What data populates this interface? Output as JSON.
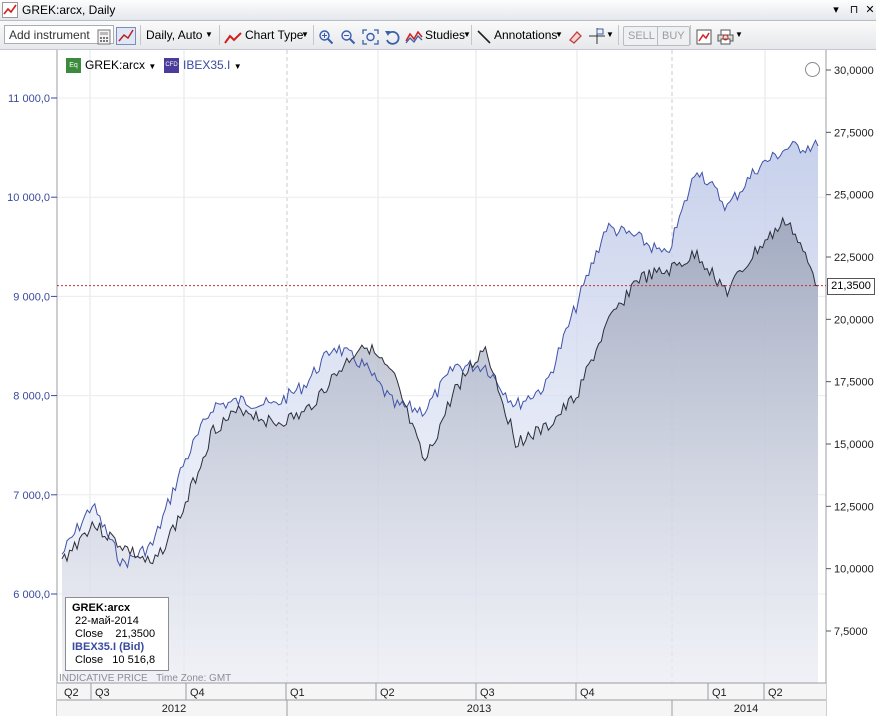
{
  "window": {
    "title": "GREK:arcx, Daily",
    "controls": [
      "▾",
      "⊓",
      "✕"
    ]
  },
  "toolbar": {
    "add_instrument_placeholder": "Add instrument",
    "interval": "Daily,  Auto",
    "chart_type": "Chart Type",
    "studies": "Studies",
    "annotations": "Annotations",
    "sell": "SELL",
    "buy": "BUY"
  },
  "legend": {
    "primary": "GREK:arcx",
    "secondary": "IBEX35.I",
    "primary_icon_label": "Eq",
    "secondary_icon_label": "CFD"
  },
  "axes": {
    "left_ticks": [
      "11 000,0",
      "10 000,0",
      "9 000,0",
      "8 000,0",
      "7 000,0",
      "6 000,0"
    ],
    "right_ticks": [
      "30,0000",
      "27,5000",
      "25,0000",
      "22,5000",
      "20,0000",
      "17,5000",
      "15,0000",
      "12,5000",
      "10,0000",
      "7,5000"
    ],
    "quarters": [
      "Q2",
      "Q3",
      "Q4",
      "Q1",
      "Q2",
      "Q3",
      "Q4",
      "Q1",
      "Q2"
    ],
    "years": [
      "2012",
      "2013",
      "2014"
    ]
  },
  "price_tag": "21,3500",
  "info": {
    "instrument": "GREK:arcx",
    "date": "22-май-2014",
    "close_label": "Close",
    "close_value": "21,3500",
    "instrument2": "IBEX35.I (Bid)",
    "close2_label": "Close",
    "close2_value": "10 516,8"
  },
  "footer": {
    "indicative": "INDICATIVE PRICE",
    "timezone": "Time Zone: GMT"
  },
  "colors": {
    "grek_line": "#2b2f3a",
    "ibex_line": "#3f52a8",
    "ref_line": "#c0303b"
  },
  "chart_data": {
    "type": "area",
    "x": [
      "2012-04",
      "2012-05",
      "2012-06",
      "2012-07",
      "2012-08",
      "2012-09",
      "2012-10",
      "2012-11",
      "2012-12",
      "2013-01",
      "2013-02",
      "2013-03",
      "2013-04",
      "2013-05",
      "2013-06",
      "2013-07",
      "2013-08",
      "2013-09",
      "2013-10",
      "2013-11",
      "2013-12",
      "2014-01",
      "2014-02",
      "2014-03",
      "2014-04",
      "2014-05"
    ],
    "series": [
      {
        "name": "GREK:arcx",
        "axis": "right",
        "values": [
          10.3,
          11.8,
          10.9,
          10.1,
          12.3,
          15.6,
          16.4,
          15.8,
          16.2,
          17.7,
          19.1,
          17.6,
          14.2,
          17.2,
          18.9,
          15.1,
          15.6,
          16.9,
          19.7,
          21.6,
          21.9,
          22.6,
          21.1,
          22.8,
          24.0,
          21.35
        ]
      },
      {
        "name": "IBEX35.I",
        "axis": "left",
        "values": [
          6400,
          6900,
          6300,
          6500,
          7300,
          7900,
          7950,
          7900,
          8100,
          8500,
          8300,
          7900,
          7850,
          8300,
          8300,
          7900,
          8100,
          8900,
          9700,
          9600,
          9400,
          10300,
          9900,
          10300,
          10500,
          10517
        ]
      }
    ],
    "left_ylim": [
      5500,
      11500
    ],
    "right_ylim": [
      5000,
      31000
    ],
    "reference_line": 21.35
  }
}
